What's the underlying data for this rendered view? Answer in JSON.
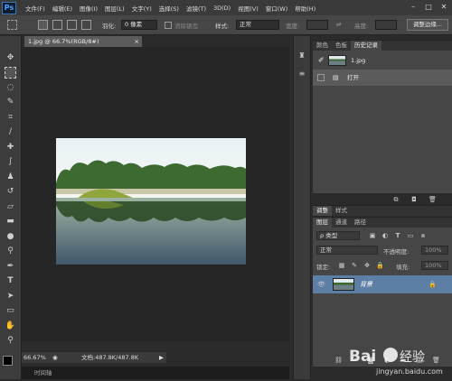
{
  "app": {
    "logo": "Ps"
  },
  "menu": [
    "文件(F)",
    "编辑(E)",
    "图像(I)",
    "图层(L)",
    "文字(Y)",
    "选择(S)",
    "滤镜(T)",
    "3D(D)",
    "视图(V)",
    "窗口(W)",
    "帮助(H)"
  ],
  "window_controls": {
    "minimize": "–",
    "maximize": "□",
    "close": "✕"
  },
  "options_bar": {
    "feather_label": "羽化:",
    "feather_value": "0 像素",
    "antialias_label": "消除锯齿",
    "style_label": "样式:",
    "style_value": "正常",
    "width_label": "宽度:",
    "height_label": "高度:",
    "refine_edge_button": "调整边缘..."
  },
  "document": {
    "tab_title": "1.jpg @ 66.7%(RGB/8#)",
    "zoom": "66.67%",
    "doc_size": "文档:487.8K/487.8K",
    "timeline_label": "时间轴"
  },
  "history_panel": {
    "tabs": [
      "颜色",
      "色板",
      "历史记录"
    ],
    "active_tab": "历史记录",
    "snapshot_name": "1.jpg",
    "items": [
      "打开"
    ]
  },
  "adjust_panel": {
    "tabs": [
      "调整",
      "样式"
    ]
  },
  "layers_panel": {
    "tabs": [
      "图层",
      "通道",
      "路径"
    ],
    "active_tab": "图层",
    "filter_label": "ρ 类型",
    "blend_mode": "正常",
    "opacity_label": "不透明度:",
    "opacity_value": "100%",
    "lock_label": "锁定:",
    "fill_label": "填充:",
    "fill_value": "100%",
    "layers": [
      {
        "name": "背景",
        "visible": true,
        "locked": true
      }
    ]
  },
  "watermark": {
    "brand": "Baidu 经验",
    "url": "jingyan.baidu.com"
  },
  "colors": {
    "menubar": "#3a3a3a",
    "panel": "#464646",
    "canvas": "#262626",
    "layer_selected": "#5e7fa5"
  }
}
